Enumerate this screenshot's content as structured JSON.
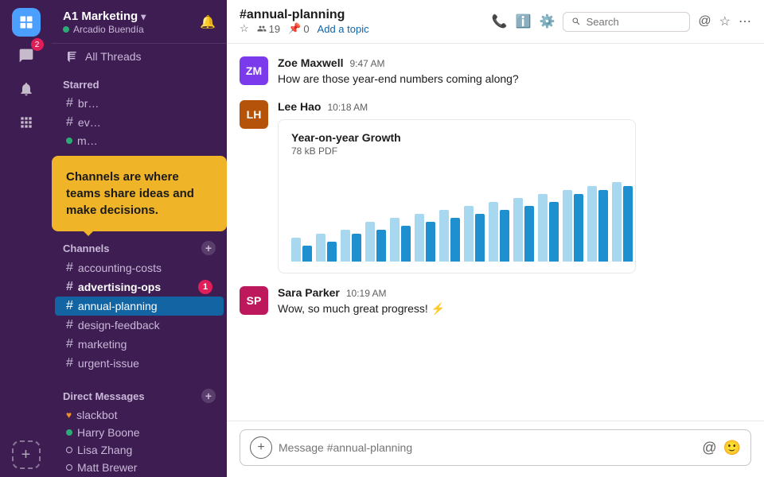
{
  "workspace": {
    "name": "A1 Marketing",
    "user": "Arcadio Buendía",
    "status": "active"
  },
  "sidebar": {
    "all_threads_label": "All Threads",
    "starred_label": "Starred",
    "starred_items": [
      {
        "id": "br",
        "name": "br…",
        "type": "channel"
      },
      {
        "id": "ev",
        "name": "ev…",
        "type": "channel"
      },
      {
        "id": "m",
        "name": "m…",
        "type": "channel",
        "active_dot": true
      }
    ],
    "channels_label": "Channels",
    "channels": [
      {
        "name": "accounting-costs",
        "bold": false,
        "badge": null
      },
      {
        "name": "advertising-ops",
        "bold": true,
        "badge": "1"
      },
      {
        "name": "annual-planning",
        "bold": false,
        "badge": null,
        "active": true
      },
      {
        "name": "design-feedback",
        "bold": false,
        "badge": null
      },
      {
        "name": "marketing",
        "bold": false,
        "badge": null
      },
      {
        "name": "urgent-issue",
        "bold": false,
        "badge": null
      }
    ],
    "dm_label": "Direct Messages",
    "dms": [
      {
        "name": "slackbot",
        "status": "heart"
      },
      {
        "name": "Harry Boone",
        "status": "green"
      },
      {
        "name": "Lisa Zhang",
        "status": "empty"
      },
      {
        "name": "Matt Brewer",
        "status": "empty"
      }
    ]
  },
  "channel": {
    "name": "#annual-planning",
    "members": "19",
    "pins": "0",
    "topic_placeholder": "Add a topic"
  },
  "search": {
    "placeholder": "Search"
  },
  "messages": [
    {
      "id": "msg1",
      "author": "Zoe Maxwell",
      "time": "9:47 AM",
      "text": "How are those year-end numbers coming along?",
      "avatar_initials": "ZM",
      "avatar_class": "zoe"
    },
    {
      "id": "msg2",
      "author": "Lee Hao",
      "time": "10:18 AM",
      "text": "",
      "avatar_initials": "LH",
      "avatar_class": "lee",
      "has_chart": true
    },
    {
      "id": "msg3",
      "author": "Sara Parker",
      "time": "10:19 AM",
      "text": "Wow, so much great progress! ⚡",
      "avatar_initials": "SP",
      "avatar_class": "sara"
    }
  ],
  "chart": {
    "title": "Year-on-year Growth",
    "subtitle": "78 kB PDF",
    "bars": [
      {
        "light": 30,
        "dark": 20
      },
      {
        "light": 35,
        "dark": 25
      },
      {
        "light": 40,
        "dark": 35
      },
      {
        "light": 50,
        "dark": 40
      },
      {
        "light": 55,
        "dark": 45
      },
      {
        "light": 60,
        "dark": 50
      },
      {
        "light": 65,
        "dark": 55
      },
      {
        "light": 70,
        "dark": 60
      },
      {
        "light": 75,
        "dark": 65
      },
      {
        "light": 80,
        "dark": 70
      },
      {
        "light": 85,
        "dark": 75
      },
      {
        "light": 90,
        "dark": 85
      },
      {
        "light": 95,
        "dark": 90
      },
      {
        "light": 100,
        "dark": 95
      }
    ]
  },
  "tooltip": {
    "text": "Channels are where teams share ideas and make decisions."
  },
  "input": {
    "placeholder": "Message #annual-planning"
  }
}
